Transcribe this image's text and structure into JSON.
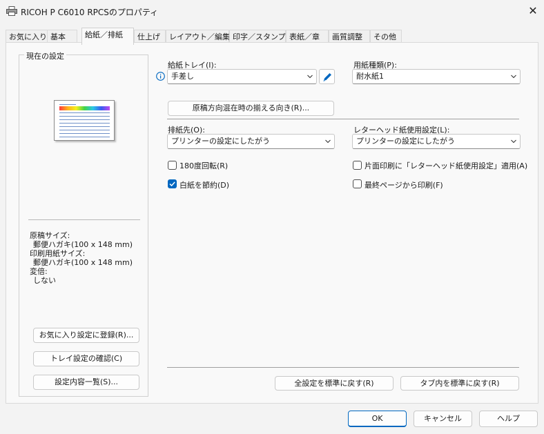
{
  "window": {
    "title": "RICOH P C6010 RPCSのプロパティ",
    "icons": {
      "app": "printer-icon",
      "close": "close-icon"
    }
  },
  "tabs": [
    {
      "label": "お気に入り",
      "active": false
    },
    {
      "label": "基本",
      "active": false
    },
    {
      "label": "給紙／排紙",
      "active": true
    },
    {
      "label": "仕上げ",
      "active": false
    },
    {
      "label": "レイアウト／編集",
      "active": false
    },
    {
      "label": "印字／スタンプ",
      "active": false
    },
    {
      "label": "表紙／章",
      "active": false
    },
    {
      "label": "画質調整",
      "active": false
    },
    {
      "label": "その他",
      "active": false
    }
  ],
  "current_settings": {
    "title": "現在の設定",
    "info": {
      "original_size_label": "原稿サイズ:",
      "original_size_value": "郵便ハガキ(100 x 148 mm)",
      "print_size_label": "印刷用紙サイズ:",
      "print_size_value": "郵便ハガキ(100 x 148 mm)",
      "scale_label": "変倍:",
      "scale_value": "しない"
    },
    "buttons": {
      "register_favorite": "お気に入り設定に登録(R)...",
      "check_tray": "トレイ設定の確認(C)",
      "settings_list": "設定内容一覧(S)..."
    }
  },
  "paper": {
    "tray_label": "給紙トレイ(I):",
    "tray_value": "手差し",
    "type_label": "用紙種類(P):",
    "type_value": "耐水紙1",
    "orientation_button": "原稿方向混在時の揃える向き(R)...",
    "output_label": "排紙先(O):",
    "output_value": "プリンターの設定にしたがう",
    "letterhead_label": "レターヘッド紙使用設定(L):",
    "letterhead_value": "プリンターの設定にしたがう"
  },
  "checkboxes": {
    "rotate180": {
      "label": "180度回転(R)",
      "checked": false
    },
    "save_blank": {
      "label": "白紙を節約(D)",
      "checked": true
    },
    "letterhead_simplex": {
      "label": "片面印刷に「レターヘッド紙使用設定」適用(A)",
      "checked": false
    },
    "last_page_first": {
      "label": "最終ページから印刷(F)",
      "checked": false
    }
  },
  "reset": {
    "all_default": "全設定を標準に戻す(R)",
    "tab_default": "タブ内を標準に戻す(R)"
  },
  "footer": {
    "ok": "OK",
    "cancel": "キャンセル",
    "help": "ヘルプ"
  },
  "colors": {
    "accent": "#0067c0",
    "pen_icon": "#0067c0"
  }
}
